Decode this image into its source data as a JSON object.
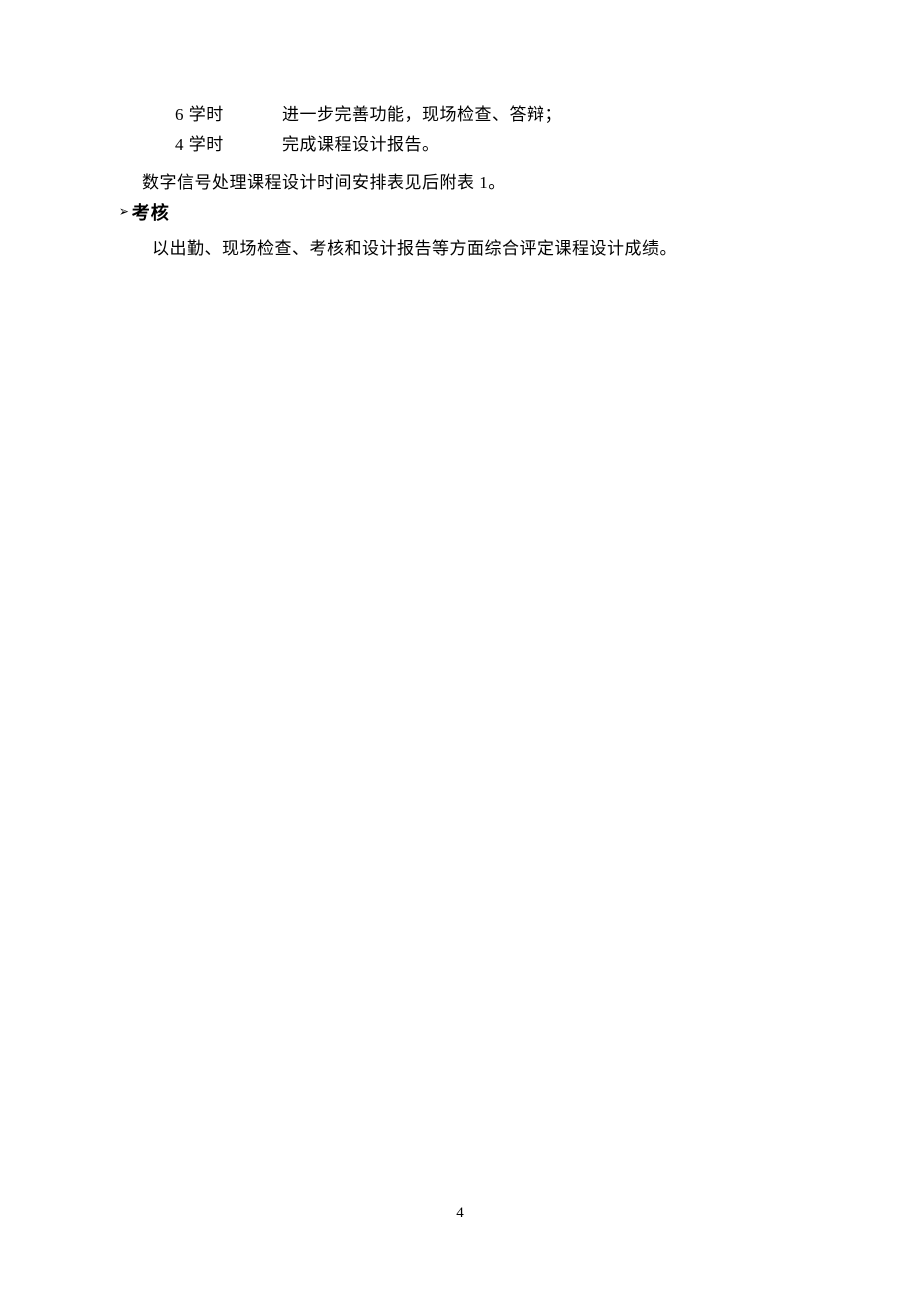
{
  "rows": [
    {
      "hours": "6 学时",
      "desc": "进一步完善功能，现场检查、答辩；"
    },
    {
      "hours": "4 学时",
      "desc": "完成课程设计报告。"
    }
  ],
  "schedule_note": "数字信号处理课程设计时间安排表见后附表 1。",
  "arrow": "➢",
  "heading": "考核",
  "body": "以出勤、现场检查、考核和设计报告等方面综合评定课程设计成绩。",
  "page_number": "4"
}
